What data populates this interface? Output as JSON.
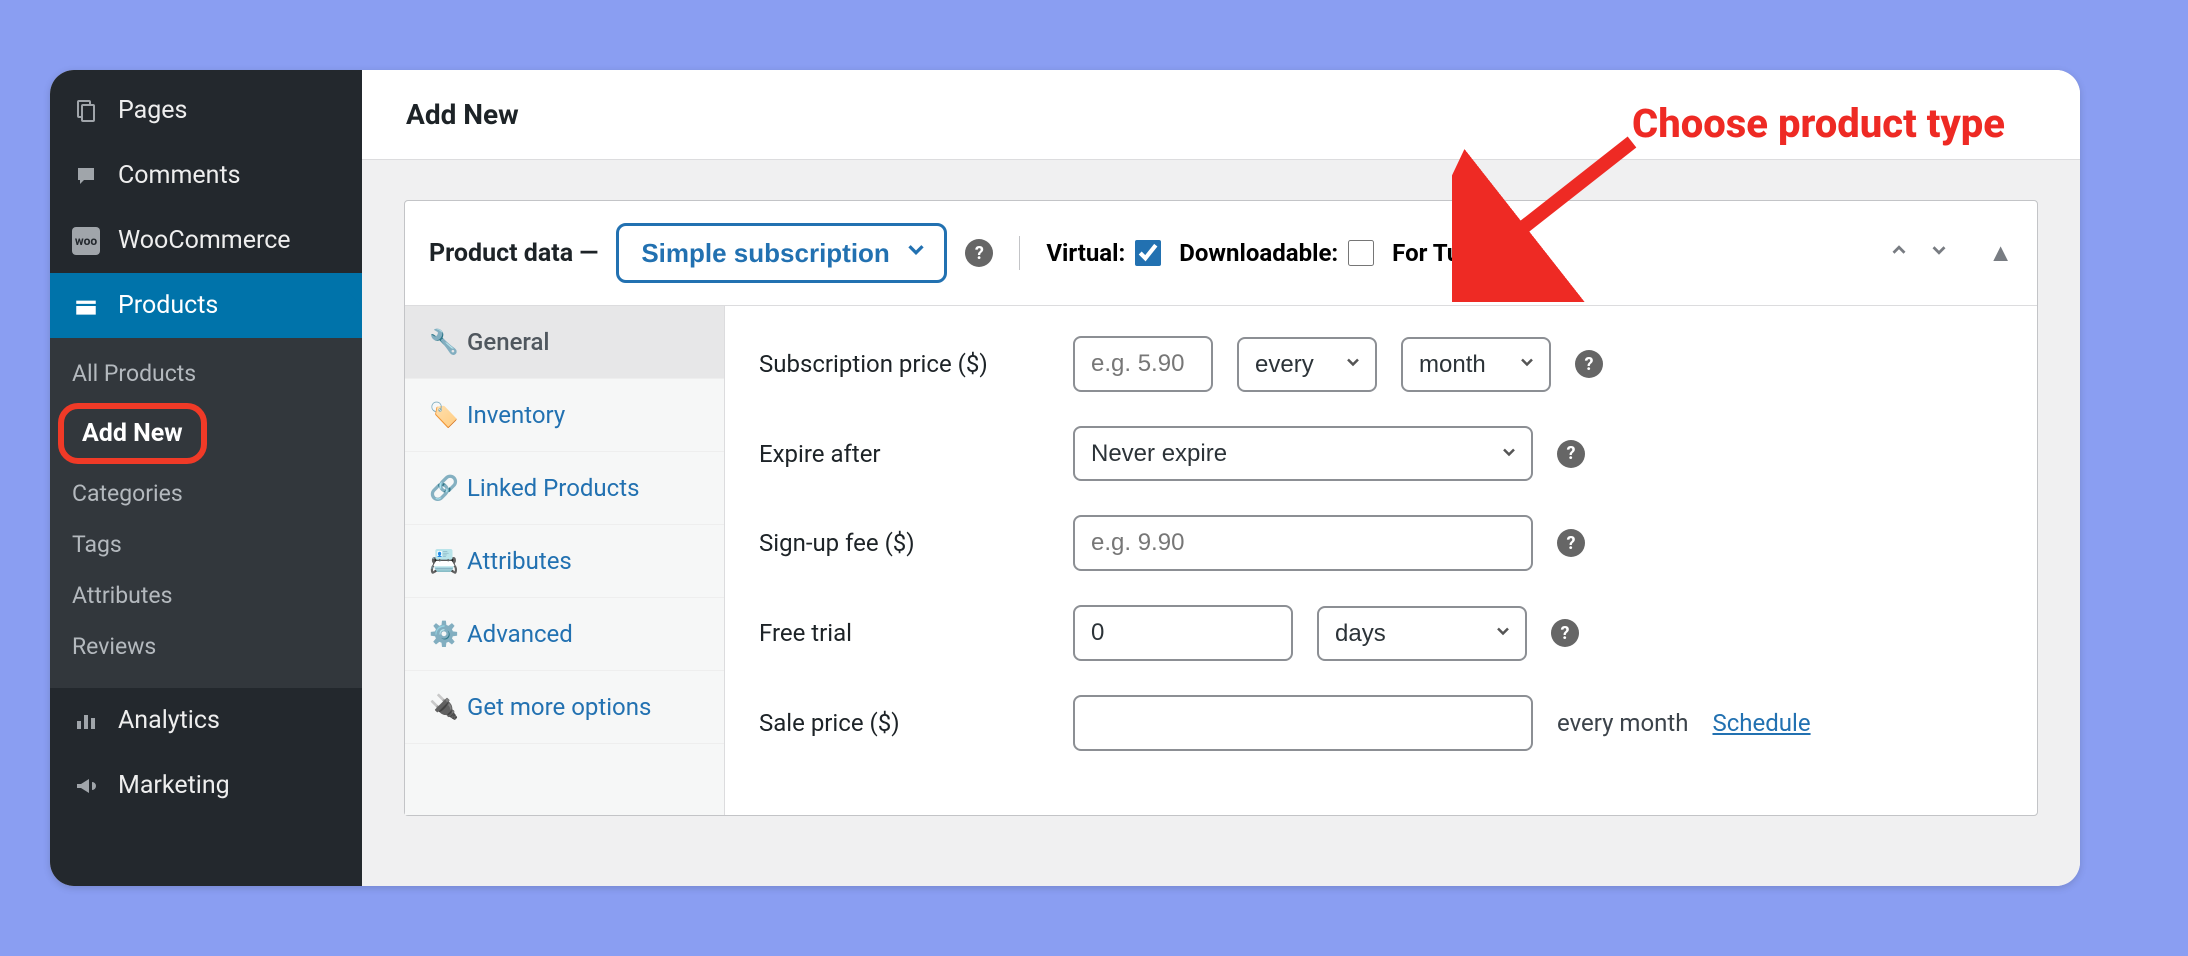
{
  "annotation": {
    "text": "Choose product type"
  },
  "page_title": "Add New",
  "sidebar": {
    "items": [
      {
        "label": "Pages"
      },
      {
        "label": "Comments"
      },
      {
        "label": "WooCommerce"
      },
      {
        "label": "Products"
      },
      {
        "label": "Analytics"
      },
      {
        "label": "Marketing"
      }
    ],
    "sub_items": [
      {
        "label": "All Products"
      },
      {
        "label": "Add New"
      },
      {
        "label": "Categories"
      },
      {
        "label": "Tags"
      },
      {
        "label": "Attributes"
      },
      {
        "label": "Reviews"
      }
    ]
  },
  "panel": {
    "header_label": "Product data —",
    "product_type": "Simple subscription",
    "virtual": {
      "label": "Virtual:",
      "checked": true
    },
    "downloadable": {
      "label": "Downloadable:",
      "checked": false
    },
    "for_tutor": {
      "label": "For Tutor:",
      "checked": true
    }
  },
  "tabs": [
    {
      "label": "General"
    },
    {
      "label": "Inventory"
    },
    {
      "label": "Linked Products"
    },
    {
      "label": "Attributes"
    },
    {
      "label": "Advanced"
    },
    {
      "label": "Get more options"
    }
  ],
  "fields": {
    "sub_price_label": "Subscription price ($)",
    "sub_price_placeholder": "e.g. 5.90",
    "sub_interval": "every",
    "sub_period": "month",
    "expire_label": "Expire after",
    "expire_value": "Never expire",
    "signup_label": "Sign-up fee ($)",
    "signup_placeholder": "e.g. 9.90",
    "trial_label": "Free trial",
    "trial_value": "0",
    "trial_unit": "days",
    "sale_label": "Sale price ($)",
    "sale_note": "every month",
    "sale_schedule": "Schedule"
  }
}
